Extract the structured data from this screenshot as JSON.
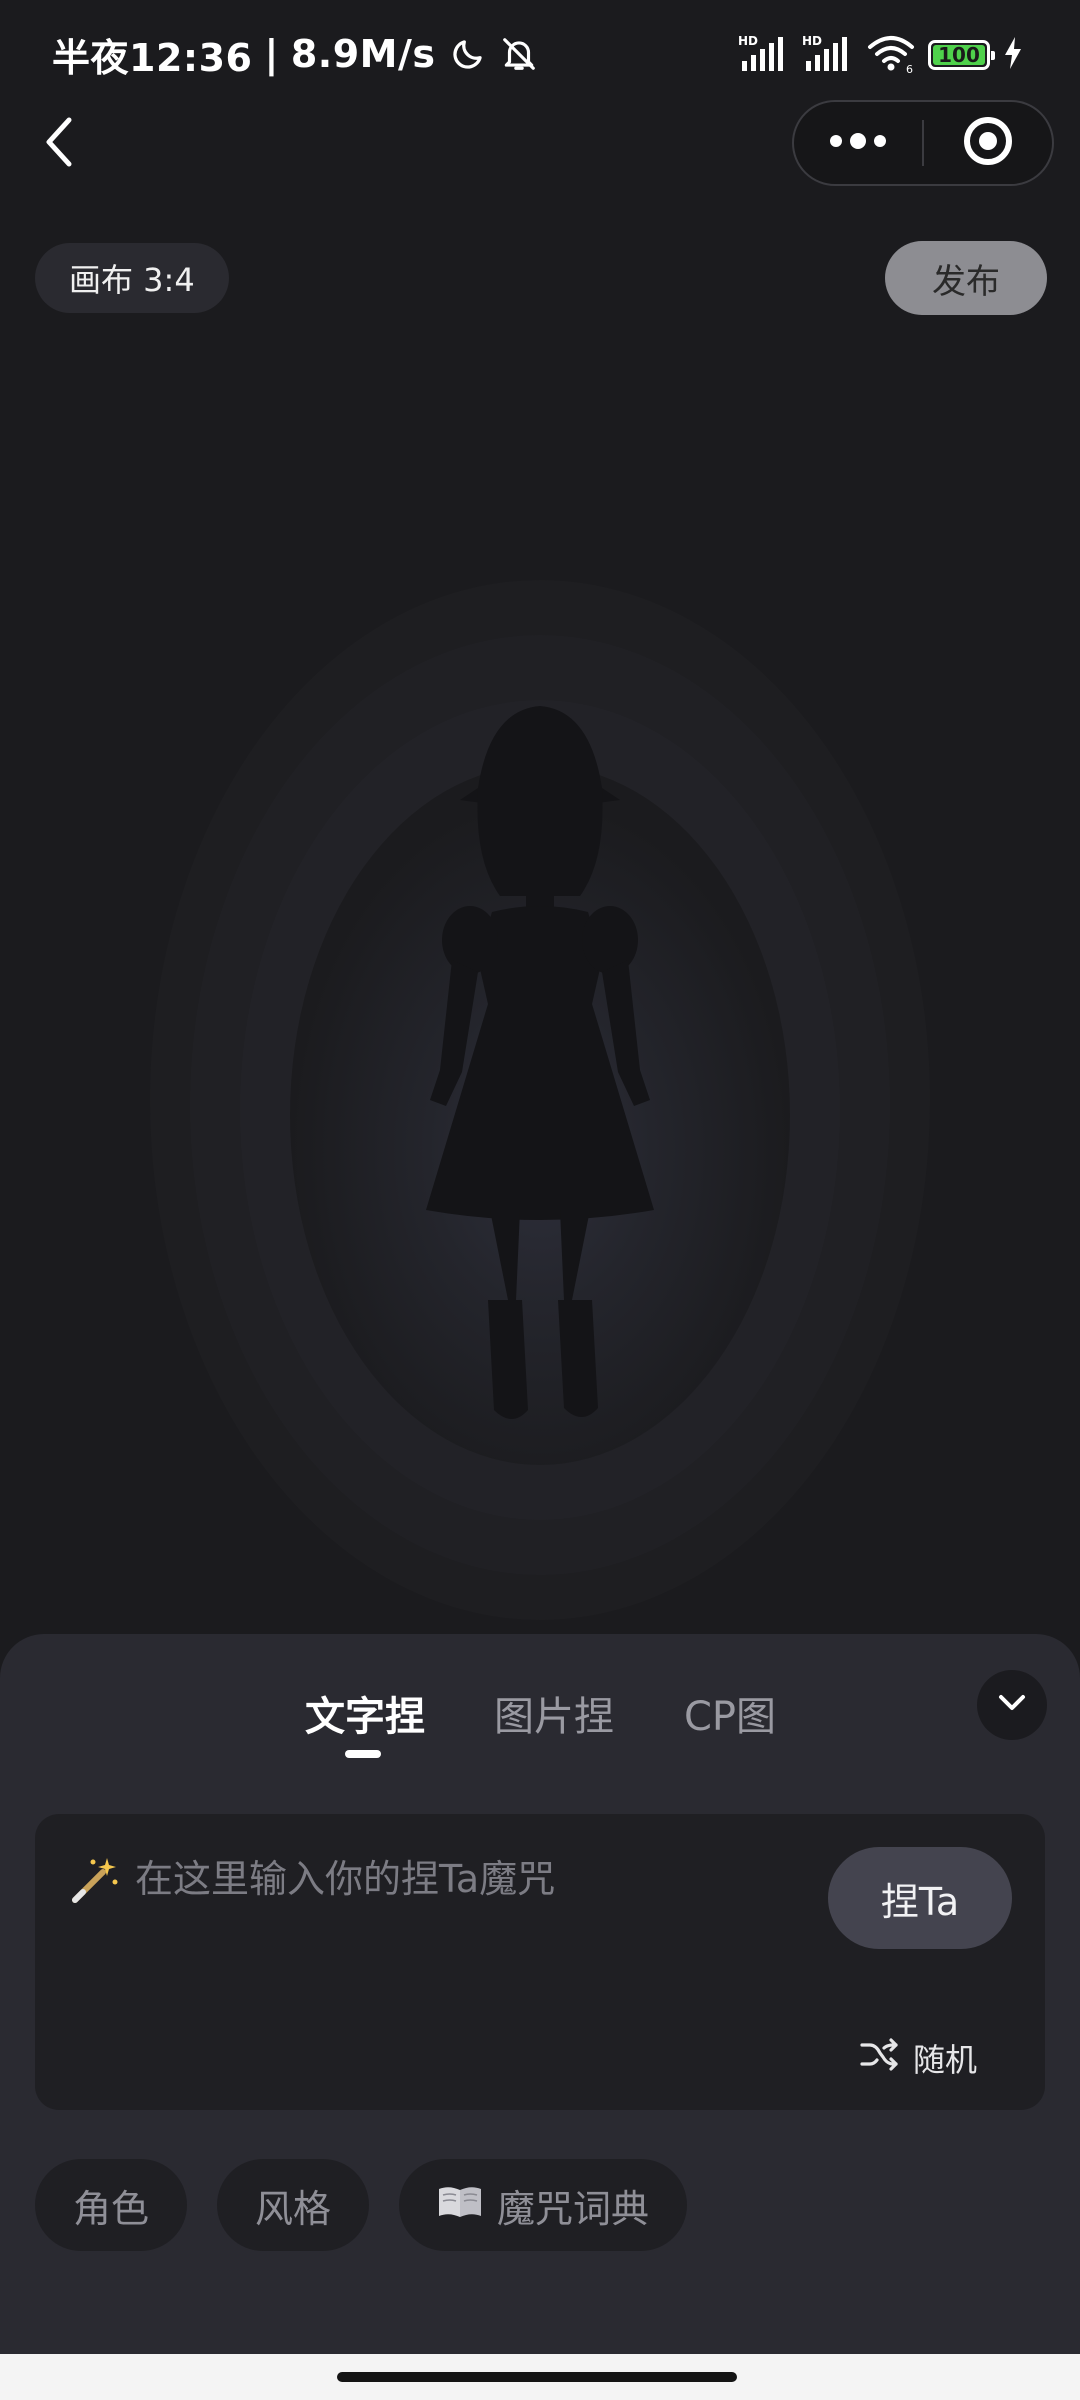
{
  "status_bar": {
    "time": "半夜12:36",
    "network_speed": "8.9M/s",
    "battery_level": "100",
    "icons": [
      "moon-icon",
      "bell-off-icon",
      "hd-signal-icon",
      "hd-signal-icon",
      "wifi-icon",
      "battery-icon",
      "charging-icon"
    ]
  },
  "nav": {
    "back_icon": "chevron-left-icon",
    "more_icon": "more-dots-icon",
    "close_icon": "target-circle-icon"
  },
  "canvas": {
    "ratio_label": "画布 3:4",
    "publish_label": "发布"
  },
  "panel": {
    "tabs": [
      {
        "label": "文字捏",
        "active": true
      },
      {
        "label": "图片捏",
        "active": false
      },
      {
        "label": "CP图",
        "active": false
      }
    ],
    "collapse_icon": "chevron-down-icon",
    "prompt": {
      "placeholder": "在这里输入你的捏Ta魔咒",
      "value": "",
      "icon": "magic-wand-icon"
    },
    "submit_label": "捏Ta",
    "random_label": "随机",
    "random_icon": "shuffle-icon",
    "chips": [
      {
        "label": "角色"
      },
      {
        "label": "风格"
      },
      {
        "label": "魔咒词典",
        "icon": "book-icon"
      }
    ]
  },
  "colors": {
    "background": "#1b1b1e",
    "panel": "#2a2a31",
    "battery": "#4fd14b",
    "publish_button": "#8d8d92"
  }
}
